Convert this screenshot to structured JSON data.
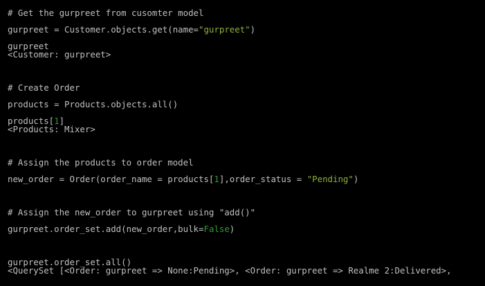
{
  "terminal": {
    "colors": {
      "background": "#000000",
      "text": "#c0c0c0",
      "string": "#8eb13c",
      "number": "#2e9e2e",
      "keyword": "#2e9e2e"
    },
    "l01": "# Get the gurpreet from cusomter model",
    "l02": {
      "a": "gurpreet = Customer.objects.get(name=",
      "s": "\"gurpreet\"",
      "b": ")"
    },
    "l03": "gurpreet",
    "l04": "<Customer: gurpreet>",
    "l05": "# Create Order",
    "l06": "products = Products.objects.all()",
    "l07": {
      "a": "products[",
      "n": "1",
      "b": "]"
    },
    "l08": "<Products: Mixer>",
    "l09": "# Assign the products to order model",
    "l10": {
      "a": "new_order = Order(order_name = products[",
      "n": "1",
      "b": "],order_status = ",
      "s": "\"Pending\"",
      "c": ")"
    },
    "l11": "# Assign the new_order to gurpreet using \"add()\"",
    "l12": {
      "a": "gurpreet.order_set.add(new_order,bulk=",
      "k": "False",
      "b": ")"
    },
    "l13": "gurpreet.order_set.all()",
    "l14": "<QuerySet [<Order: gurpreet => None:Pending>, <Order: gurpreet => Realme 2:Delivered>,"
  }
}
